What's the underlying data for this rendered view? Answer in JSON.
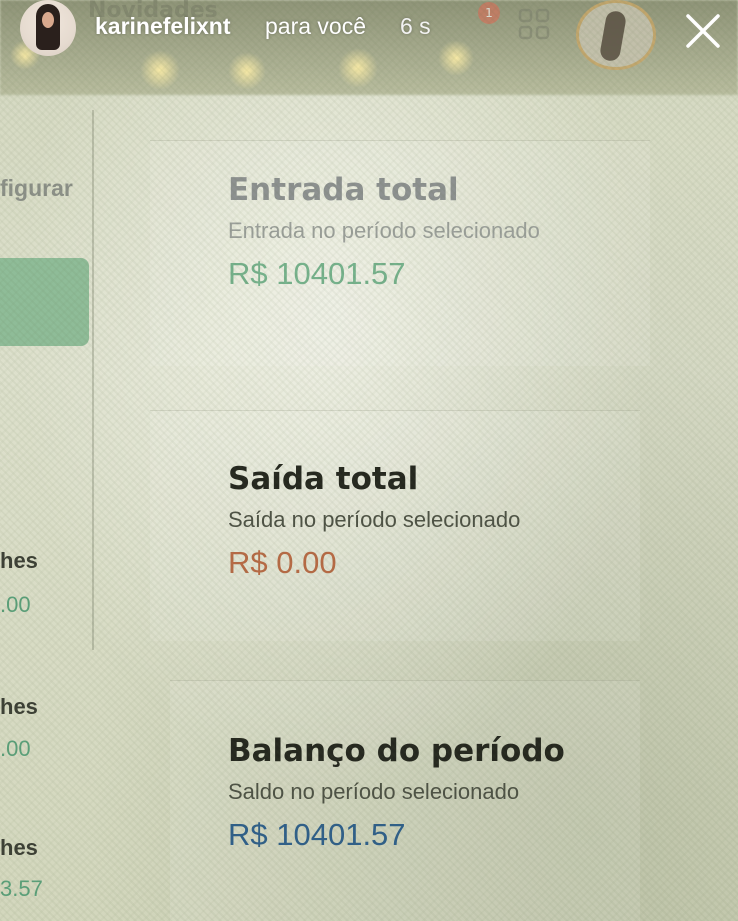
{
  "story": {
    "username": "karinefelixnt",
    "subtitle": "para você",
    "time": "6 s"
  },
  "background_app": {
    "nav_partial": "Novidades",
    "notification_badge": "1"
  },
  "left_panel": {
    "configure_partial": "figurar",
    "rows": [
      {
        "label": "hes",
        "value": ".00"
      },
      {
        "label": "hes",
        "value": ".00"
      },
      {
        "label": "hes",
        "value": "3.57"
      }
    ]
  },
  "cards": {
    "entrada": {
      "title": "Entrada total",
      "subtitle": "Entrada no período selecionado",
      "value": "R$ 10401.57"
    },
    "saida": {
      "title": "Saída total",
      "subtitle": "Saída no período selecionado",
      "value": "R$ 0.00"
    },
    "balanco": {
      "title": "Balanço do período",
      "subtitle": "Saldo no período selecionado",
      "value": "R$ 10401.57"
    }
  },
  "colors": {
    "entrada_value": "#4f9e70",
    "saida_value": "#b76a45",
    "balanco_value": "#2f5f8a",
    "story_text": "#ffffff"
  },
  "icons": [
    "close-icon",
    "grid-icon",
    "notification-badge",
    "avatar"
  ]
}
